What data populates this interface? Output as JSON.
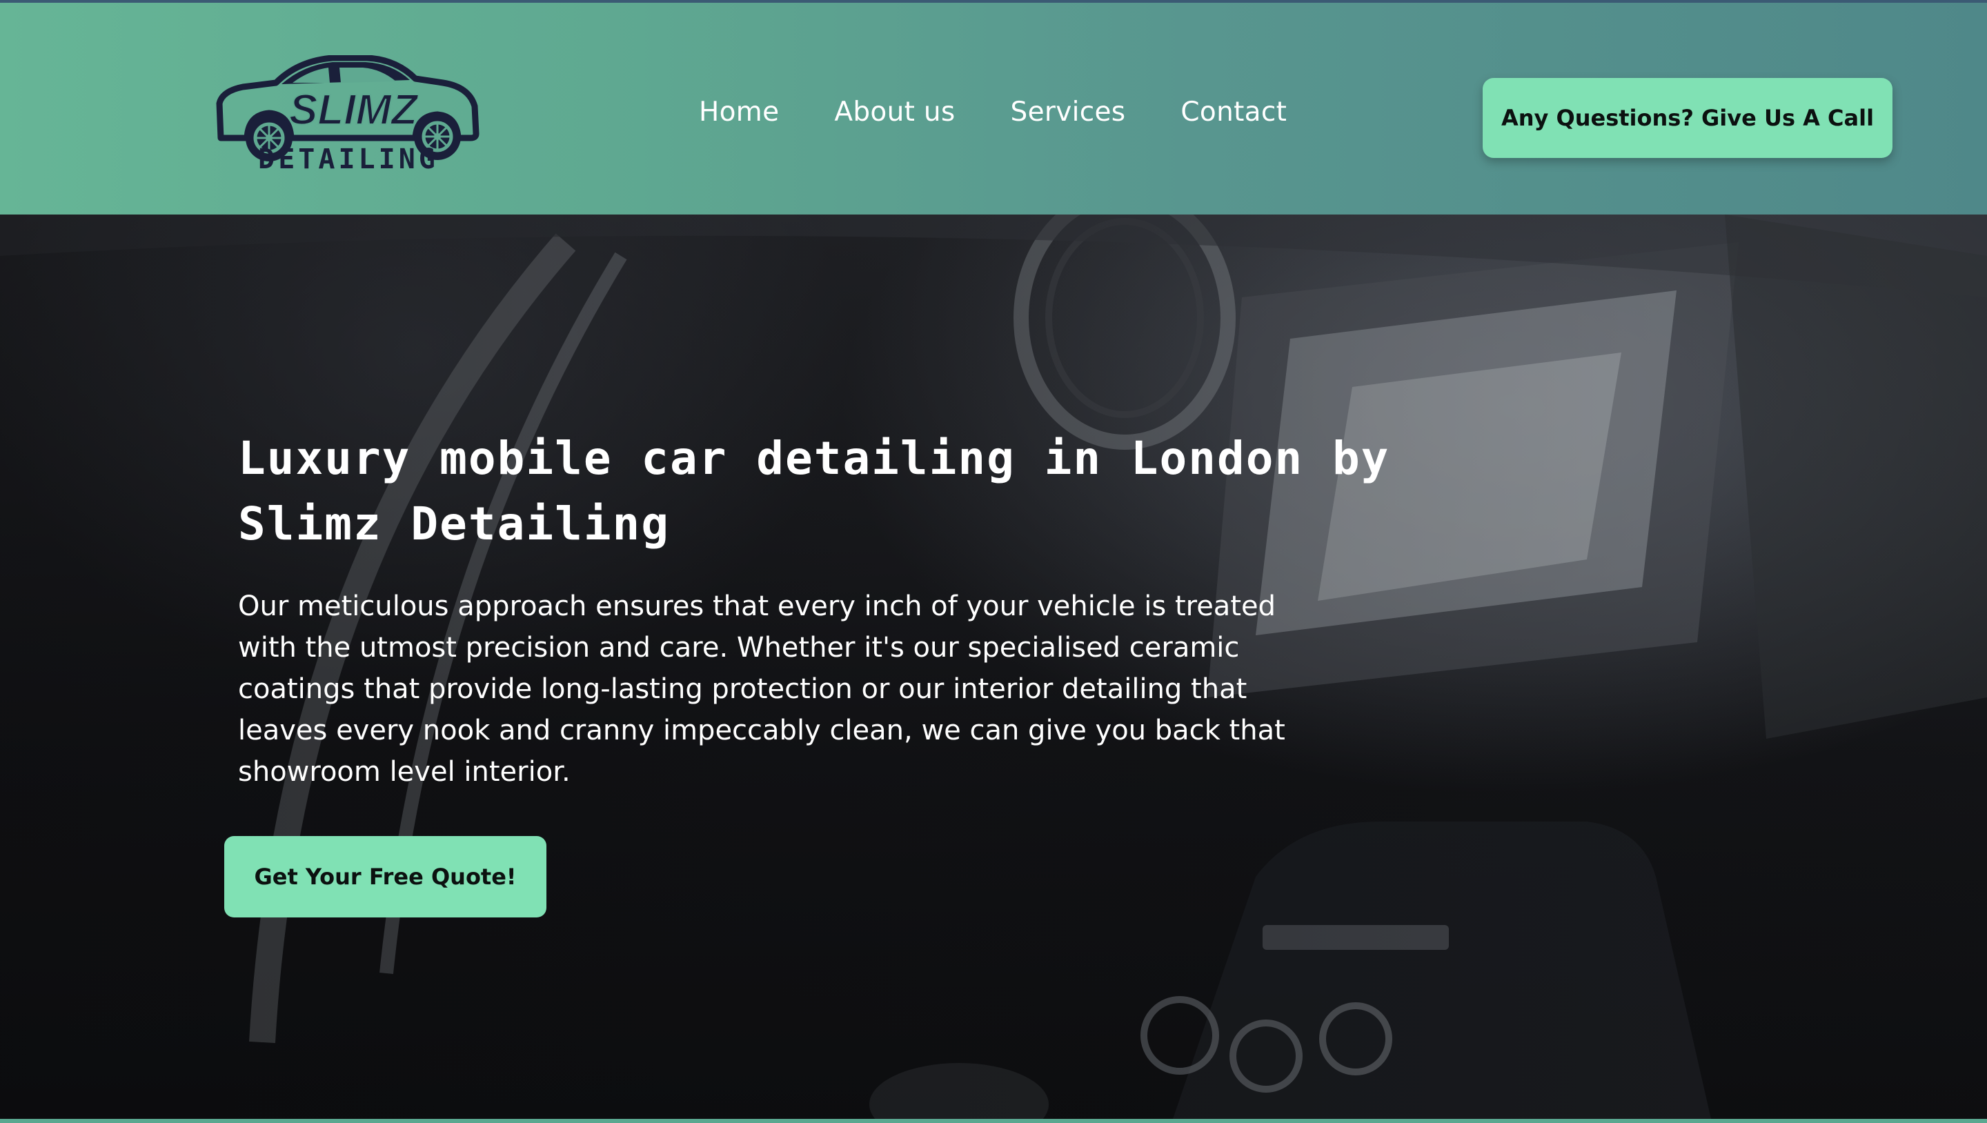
{
  "brand": {
    "logo_main_text": "SLIMZ",
    "logo_sub_text": "DETAILING",
    "accent_color": "#80e1b4",
    "header_color": "#5fa991",
    "logo_color": "#1a1f3a"
  },
  "nav": {
    "items": [
      {
        "label": "Home"
      },
      {
        "label": "About us"
      },
      {
        "label": "Services"
      },
      {
        "label": "Contact"
      }
    ]
  },
  "header": {
    "cta_label": "Any Questions? Give Us A Call"
  },
  "hero": {
    "title": "Luxury mobile car detailing in London by Slimz Detailing",
    "description": "Our meticulous approach ensures that every inch of your vehicle is treated with the utmost precision and care. Whether it's our specialised ceramic coatings that provide long-lasting protection or our interior detailing that leaves every nook and cranny impeccably clean, we can give you back that showroom level interior.",
    "cta_label": "Get Your Free Quote!",
    "background_image": "car-interior-dashboard"
  }
}
